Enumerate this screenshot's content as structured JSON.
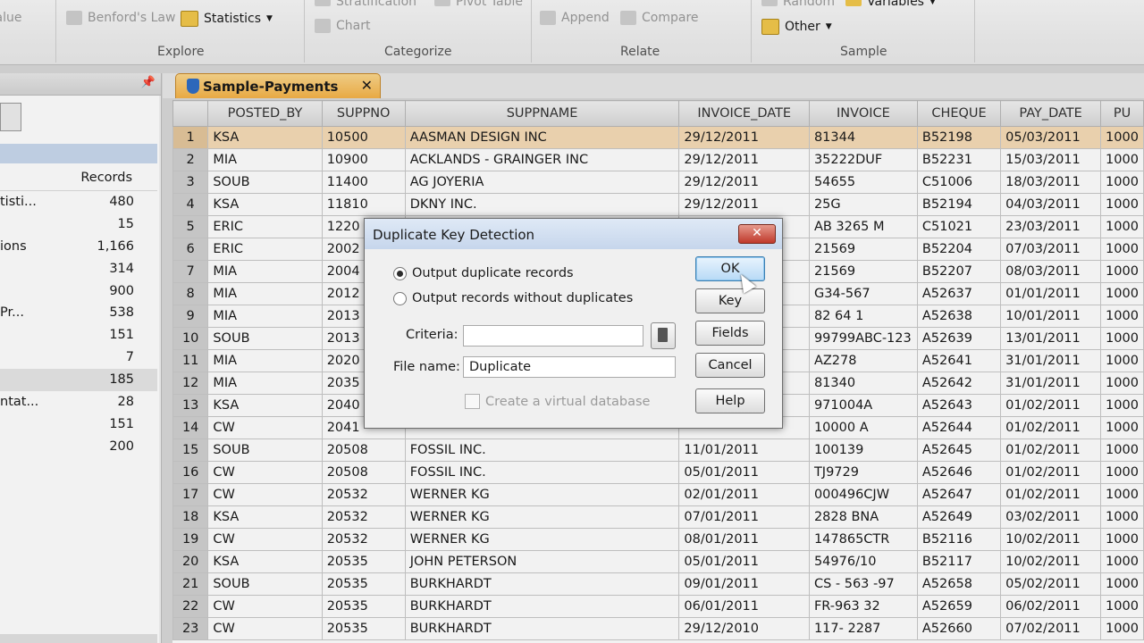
{
  "ribbon": {
    "value_label": "Value",
    "benford_label": "Benford's Law",
    "statistics_label": "Statistics",
    "stratification_label": "Stratification",
    "pivot_label": "Pivot Table",
    "chart_label": "Chart",
    "append_label": "Append",
    "compare_label": "Compare",
    "random_label": "Random",
    "variables_label": "Variables",
    "other_label": "Other",
    "groups": {
      "explore": "Explore",
      "categorize": "Categorize",
      "relate": "Relate",
      "sample": "Sample"
    }
  },
  "leftpanel": {
    "records_header": "Records",
    "rows": [
      {
        "name": "tisti...",
        "value": "480"
      },
      {
        "name": "",
        "value": "15"
      },
      {
        "name": "ions",
        "value": "1,166"
      },
      {
        "name": "",
        "value": "314"
      },
      {
        "name": "",
        "value": "900"
      },
      {
        "name": "Pr...",
        "value": "538"
      },
      {
        "name": "",
        "value": "151"
      },
      {
        "name": "",
        "value": "7"
      },
      {
        "name": "",
        "value": "185"
      },
      {
        "name": "ntat...",
        "value": "28"
      },
      {
        "name": "",
        "value": "151"
      },
      {
        "name": "",
        "value": "200"
      }
    ]
  },
  "tab": {
    "label": "Sample-Payments"
  },
  "table": {
    "columns": [
      "",
      "POSTED_BY",
      "SUPPNO",
      "SUPPNAME",
      "INVOICE_DATE",
      "INVOICE",
      "CHEQUE",
      "PAY_DATE",
      "PU"
    ],
    "rows": [
      [
        "1",
        "KSA",
        "10500",
        "AASMAN DESIGN INC",
        "29/12/2011",
        "81344",
        "B52198",
        "05/03/2011",
        "1000"
      ],
      [
        "2",
        "MIA",
        "10900",
        "ACKLANDS - GRAINGER INC",
        "29/12/2011",
        "35222DUF",
        "B52231",
        "15/03/2011",
        "1000"
      ],
      [
        "3",
        "SOUB",
        "11400",
        "AG JOYERIA",
        "29/12/2011",
        "54655",
        "C51006",
        "18/03/2011",
        "1000"
      ],
      [
        "4",
        "KSA",
        "11810",
        "DKNY  INC.",
        "29/12/2011",
        "25G",
        "B52194",
        "04/03/2011",
        "1000"
      ],
      [
        "5",
        "ERIC",
        "1220",
        "",
        "",
        "AB 3265 M",
        "C51021",
        "23/03/2011",
        "1000"
      ],
      [
        "6",
        "ERIC",
        "2002",
        "",
        "",
        "21569",
        "B52204",
        "07/03/2011",
        "1000"
      ],
      [
        "7",
        "MIA",
        "2004",
        "",
        "",
        "21569",
        "B52207",
        "08/03/2011",
        "1000"
      ],
      [
        "8",
        "MIA",
        "2012",
        "",
        "",
        "G34-567",
        "A52637",
        "01/01/2011",
        "1000"
      ],
      [
        "9",
        "MIA",
        "2013",
        "",
        "",
        "82 64 1",
        "A52638",
        "10/01/2011",
        "1000"
      ],
      [
        "10",
        "SOUB",
        "2013",
        "",
        "",
        "99799ABC-123",
        "A52639",
        "13/01/2011",
        "1000"
      ],
      [
        "11",
        "MIA",
        "2020",
        "",
        "",
        "AZ278",
        "A52641",
        "31/01/2011",
        "1000"
      ],
      [
        "12",
        "MIA",
        "2035",
        "",
        "",
        "81340",
        "A52642",
        "31/01/2011",
        "1000"
      ],
      [
        "13",
        "KSA",
        "2040",
        "",
        "",
        "971004A",
        "A52643",
        "01/02/2011",
        "1000"
      ],
      [
        "14",
        "CW",
        "2041",
        "",
        "",
        "10000 A",
        "A52644",
        "01/02/2011",
        "1000"
      ],
      [
        "15",
        "SOUB",
        "20508",
        "FOSSIL INC.",
        "11/01/2011",
        "100139",
        "A52645",
        "01/02/2011",
        "1000"
      ],
      [
        "16",
        "CW",
        "20508",
        "FOSSIL INC.",
        "05/01/2011",
        "TJ9729",
        "A52646",
        "01/02/2011",
        "1000"
      ],
      [
        "17",
        "CW",
        "20532",
        "WERNER KG",
        "02/01/2011",
        "000496CJW",
        "A52647",
        "01/02/2011",
        "1000"
      ],
      [
        "18",
        "KSA",
        "20532",
        "WERNER KG",
        "07/01/2011",
        "2828 BNA",
        "A52649",
        "03/02/2011",
        "1000"
      ],
      [
        "19",
        "CW",
        "20532",
        "WERNER KG",
        "08/01/2011",
        "147865CTR",
        "B52116",
        "10/02/2011",
        "1000"
      ],
      [
        "20",
        "KSA",
        "20535",
        "JOHN PETERSON",
        "05/01/2011",
        "54976/10",
        "B52117",
        "10/02/2011",
        "1000"
      ],
      [
        "21",
        "SOUB",
        "20535",
        "BURKHARDT",
        "09/01/2011",
        "CS - 563 -97",
        "A52658",
        "05/02/2011",
        "1000"
      ],
      [
        "22",
        "CW",
        "20535",
        "BURKHARDT",
        "06/01/2011",
        "FR-963 32",
        "A52659",
        "06/02/2011",
        "1000"
      ],
      [
        "23",
        "CW",
        "20535",
        "BURKHARDT",
        "29/12/2010",
        "117- 2287",
        "A52660",
        "07/02/2011",
        "1000"
      ]
    ]
  },
  "dialog": {
    "title": "Duplicate Key Detection",
    "close_label": "✕",
    "radio_duplicates": "Output duplicate records",
    "radio_without": "Output records without duplicates",
    "criteria_label": "Criteria:",
    "criteria_value": "",
    "filename_label": "File name:",
    "filename_value": "Duplicate",
    "virtual_db_label": "Create a virtual database",
    "ok_label": "OK",
    "key_label": "Key",
    "fields_label": "Fields",
    "cancel_label": "Cancel",
    "help_label": "Help"
  },
  "colors": {
    "accent": "#f5b348",
    "selected_row": "#f6dcb7",
    "dialog_title": "#c6d6ec"
  }
}
